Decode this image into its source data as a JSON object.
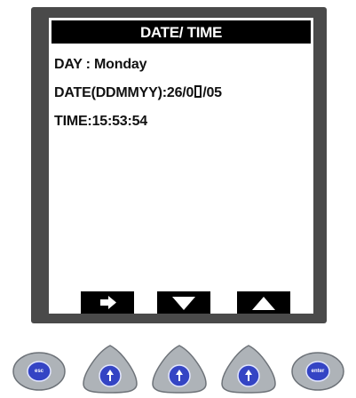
{
  "screen": {
    "title": "DATE/ TIME",
    "day_label": "DAY : ",
    "day_value": "Monday",
    "date_label": "DATE(DDMMYY):",
    "date_value_pre": "26/0",
    "date_value_post": "/05",
    "time_label": "TIME:",
    "time_value": "15:53:54"
  },
  "softkeys": [
    {
      "icon": "arrow-right-icon"
    },
    {
      "icon": "arrow-down-icon"
    },
    {
      "icon": "arrow-up-icon"
    }
  ],
  "hardware_buttons": [
    {
      "label": "esc",
      "icon": "esc-icon"
    },
    {
      "label": "",
      "icon": "arrow-up-icon"
    },
    {
      "label": "",
      "icon": "arrow-up-icon"
    },
    {
      "label": "",
      "icon": "arrow-up-icon"
    },
    {
      "label": "enter",
      "icon": "enter-icon"
    }
  ],
  "colors": {
    "device_frame": "#4a4a4a",
    "title_bar": "#000000",
    "button_body": "#9aa0a6",
    "button_center": "#2f3fbf"
  }
}
